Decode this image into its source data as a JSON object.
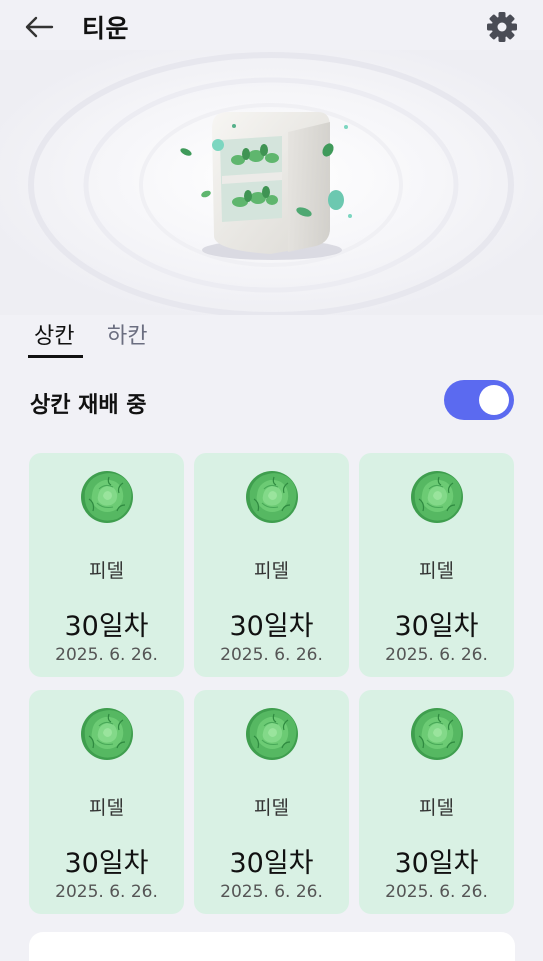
{
  "header": {
    "title": "티운"
  },
  "tabs": [
    {
      "label": "상칸",
      "selected": true
    },
    {
      "label": "하칸",
      "selected": false
    }
  ],
  "status": {
    "label": "상칸 재배 중",
    "toggle_on": true
  },
  "colors": {
    "accent": "#5b6af0",
    "card_bg": "#d9f1e4",
    "page_bg": "#f1f1f6"
  },
  "cards": [
    {
      "icon": "lettuce-icon",
      "name": "피델",
      "day": "30일차",
      "date": "2025. 6. 26."
    },
    {
      "icon": "lettuce-icon",
      "name": "피델",
      "day": "30일차",
      "date": "2025. 6. 26."
    },
    {
      "icon": "lettuce-icon",
      "name": "피델",
      "day": "30일차",
      "date": "2025. 6. 26."
    },
    {
      "icon": "lettuce-icon",
      "name": "피델",
      "day": "30일차",
      "date": "2025. 6. 26."
    },
    {
      "icon": "lettuce-icon",
      "name": "피델",
      "day": "30일차",
      "date": "2025. 6. 26."
    },
    {
      "icon": "lettuce-icon",
      "name": "피델",
      "day": "30일차",
      "date": "2025. 6. 26."
    }
  ]
}
